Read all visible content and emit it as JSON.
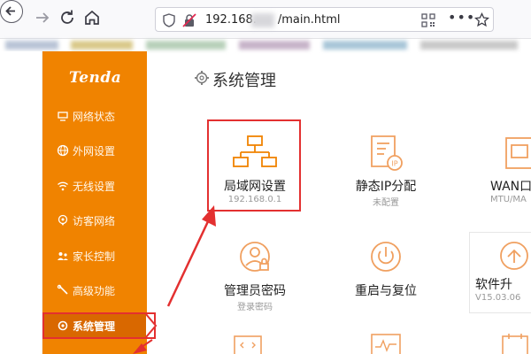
{
  "browser": {
    "url_prefix": "192.168.",
    "url_suffix": "/main.html",
    "colors": {
      "bookmark_blur": [
        "#8fa7c9",
        "#d9c98a",
        "#b7d0b9",
        "#caa9c9",
        "#9cc3d6"
      ]
    }
  },
  "sidebar": {
    "logo": "Tenda",
    "items": [
      {
        "label": "网络状态",
        "icon": "network-status-icon"
      },
      {
        "label": "外网设置",
        "icon": "globe-icon"
      },
      {
        "label": "无线设置",
        "icon": "wifi-icon"
      },
      {
        "label": "访客网络",
        "icon": "guest-icon"
      },
      {
        "label": "家长控制",
        "icon": "parental-icon"
      },
      {
        "label": "高级功能",
        "icon": "wrench-icon"
      },
      {
        "label": "系统管理",
        "icon": "gear-icon",
        "active": true
      }
    ],
    "colors": {
      "background": "#f08300",
      "active": "#d96800"
    }
  },
  "main": {
    "title": "系统管理",
    "tiles": [
      {
        "name": "局域网设置",
        "sub": "192.168.0.1",
        "icon": "lan-network-icon"
      },
      {
        "name": "静态IP分配",
        "sub": "未配置",
        "icon": "static-ip-icon"
      },
      {
        "name": "WAN口",
        "sub": "MTU/MA",
        "icon": "wan-port-icon"
      },
      {
        "name": "管理员密码",
        "sub": "登录密码",
        "icon": "admin-password-icon"
      },
      {
        "name": "重启与复位",
        "sub": "",
        "icon": "power-icon"
      },
      {
        "name": "软件升",
        "sub": "V15.03.06",
        "icon": "upgrade-icon"
      }
    ],
    "colors": {
      "accent": "#f08300",
      "annotation": "#e33030"
    }
  }
}
